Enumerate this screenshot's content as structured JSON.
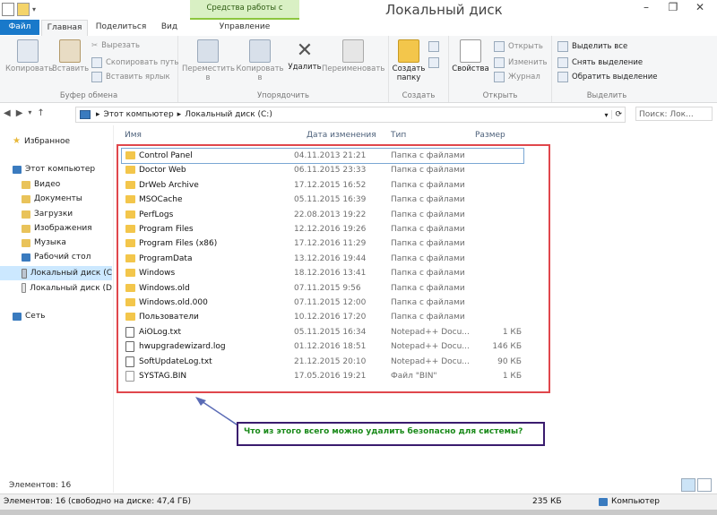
{
  "window": {
    "title": "Локальный диск (C:)",
    "context_tab_group": "Средства работы с дисками",
    "buttons": [
      "–",
      "❐",
      "✕"
    ]
  },
  "tabs": {
    "file": "Файл",
    "home": "Главная",
    "share": "Поделиться",
    "view": "Вид",
    "manage": "Управление"
  },
  "ribbon": {
    "clipboard": {
      "label": "Буфер обмена",
      "copy": "Копировать",
      "paste": "Вставить",
      "cut": "Вырезать",
      "copy_path": "Скопировать путь",
      "paste_shortcut": "Вставить ярлык"
    },
    "organize": {
      "label": "Упорядочить",
      "move_to": "Переместить в",
      "copy_to": "Копировать в",
      "delete": "Удалить",
      "rename": "Переименовать"
    },
    "new": {
      "label": "Создать",
      "new_folder": "Создать папку"
    },
    "open": {
      "label": "Открыть",
      "properties": "Свойства",
      "open": "Открыть",
      "edit": "Изменить",
      "history": "Журнал"
    },
    "select": {
      "label": "Выделить",
      "select_all": "Выделить все",
      "select_none": "Снять выделение",
      "invert": "Обратить выделение"
    }
  },
  "address": {
    "crumbs": [
      "Этот компьютер",
      "Локальный диск (C:)"
    ],
    "search_placeholder": "Поиск: Лок..."
  },
  "nav": {
    "favorites": "Избранное",
    "this_pc": "Этот компьютер",
    "items": [
      "Видео",
      "Документы",
      "Загрузки",
      "Изображения",
      "Музыка",
      "Рабочий стол",
      "Локальный диск (C",
      "Локальный диск (D"
    ],
    "network": "Сеть"
  },
  "columns": {
    "name": "Имя",
    "date": "Дата изменения",
    "type": "Тип",
    "size": "Размер"
  },
  "files": [
    {
      "name": "Control Panel",
      "date": "04.11.2013 21:21",
      "type": "Папка с файлами",
      "size": "",
      "kind": "folder"
    },
    {
      "name": "Doctor Web",
      "date": "06.11.2015 23:33",
      "type": "Папка с файлами",
      "size": "",
      "kind": "folder"
    },
    {
      "name": "DrWeb Archive",
      "date": "17.12.2015 16:52",
      "type": "Папка с файлами",
      "size": "",
      "kind": "folder"
    },
    {
      "name": "MSOCache",
      "date": "05.11.2015 16:39",
      "type": "Папка с файлами",
      "size": "",
      "kind": "folder"
    },
    {
      "name": "PerfLogs",
      "date": "22.08.2013 19:22",
      "type": "Папка с файлами",
      "size": "",
      "kind": "folder"
    },
    {
      "name": "Program Files",
      "date": "12.12.2016 19:26",
      "type": "Папка с файлами",
      "size": "",
      "kind": "folder"
    },
    {
      "name": "Program Files (x86)",
      "date": "17.12.2016 11:29",
      "type": "Папка с файлами",
      "size": "",
      "kind": "folder"
    },
    {
      "name": "ProgramData",
      "date": "13.12.2016 19:44",
      "type": "Папка с файлами",
      "size": "",
      "kind": "folder"
    },
    {
      "name": "Windows",
      "date": "18.12.2016 13:41",
      "type": "Папка с файлами",
      "size": "",
      "kind": "folder"
    },
    {
      "name": "Windows.old",
      "date": "07.11.2015 9:56",
      "type": "Папка с файлами",
      "size": "",
      "kind": "folder"
    },
    {
      "name": "Windows.old.000",
      "date": "07.11.2015 12:00",
      "type": "Папка с файлами",
      "size": "",
      "kind": "folder"
    },
    {
      "name": "Пользователи",
      "date": "10.12.2016 17:20",
      "type": "Папка с файлами",
      "size": "",
      "kind": "folder"
    },
    {
      "name": "AiOLog.txt",
      "date": "05.11.2015 16:34",
      "type": "Notepad++ Docu...",
      "size": "1 КБ",
      "kind": "txt"
    },
    {
      "name": "hwupgradewizard.log",
      "date": "01.12.2016 18:51",
      "type": "Notepad++ Docu...",
      "size": "146 КБ",
      "kind": "txt"
    },
    {
      "name": "SoftUpdateLog.txt",
      "date": "21.12.2015 20:10",
      "type": "Notepad++ Docu...",
      "size": "90 КБ",
      "kind": "txt"
    },
    {
      "name": "SYSTAG.BIN",
      "date": "17.05.2016 19:21",
      "type": "Файл \"BIN\"",
      "size": "1 КБ",
      "kind": "bin"
    }
  ],
  "annotation": "Что из этого всего можно удалить безопасно для системы?",
  "status": {
    "items": "Элементов: 16",
    "items_free": "Элементов: 16 (свободно на диске: 47,4 ГБ)",
    "size": "235 КБ",
    "zone": "Компьютер"
  },
  "colors": {
    "file_tab": "#1979ca",
    "highlight_box": "#e0474c",
    "annotation_border": "#3a1c6e",
    "annotation_text": "#1a8a1a",
    "folder": "#f3c64b"
  }
}
